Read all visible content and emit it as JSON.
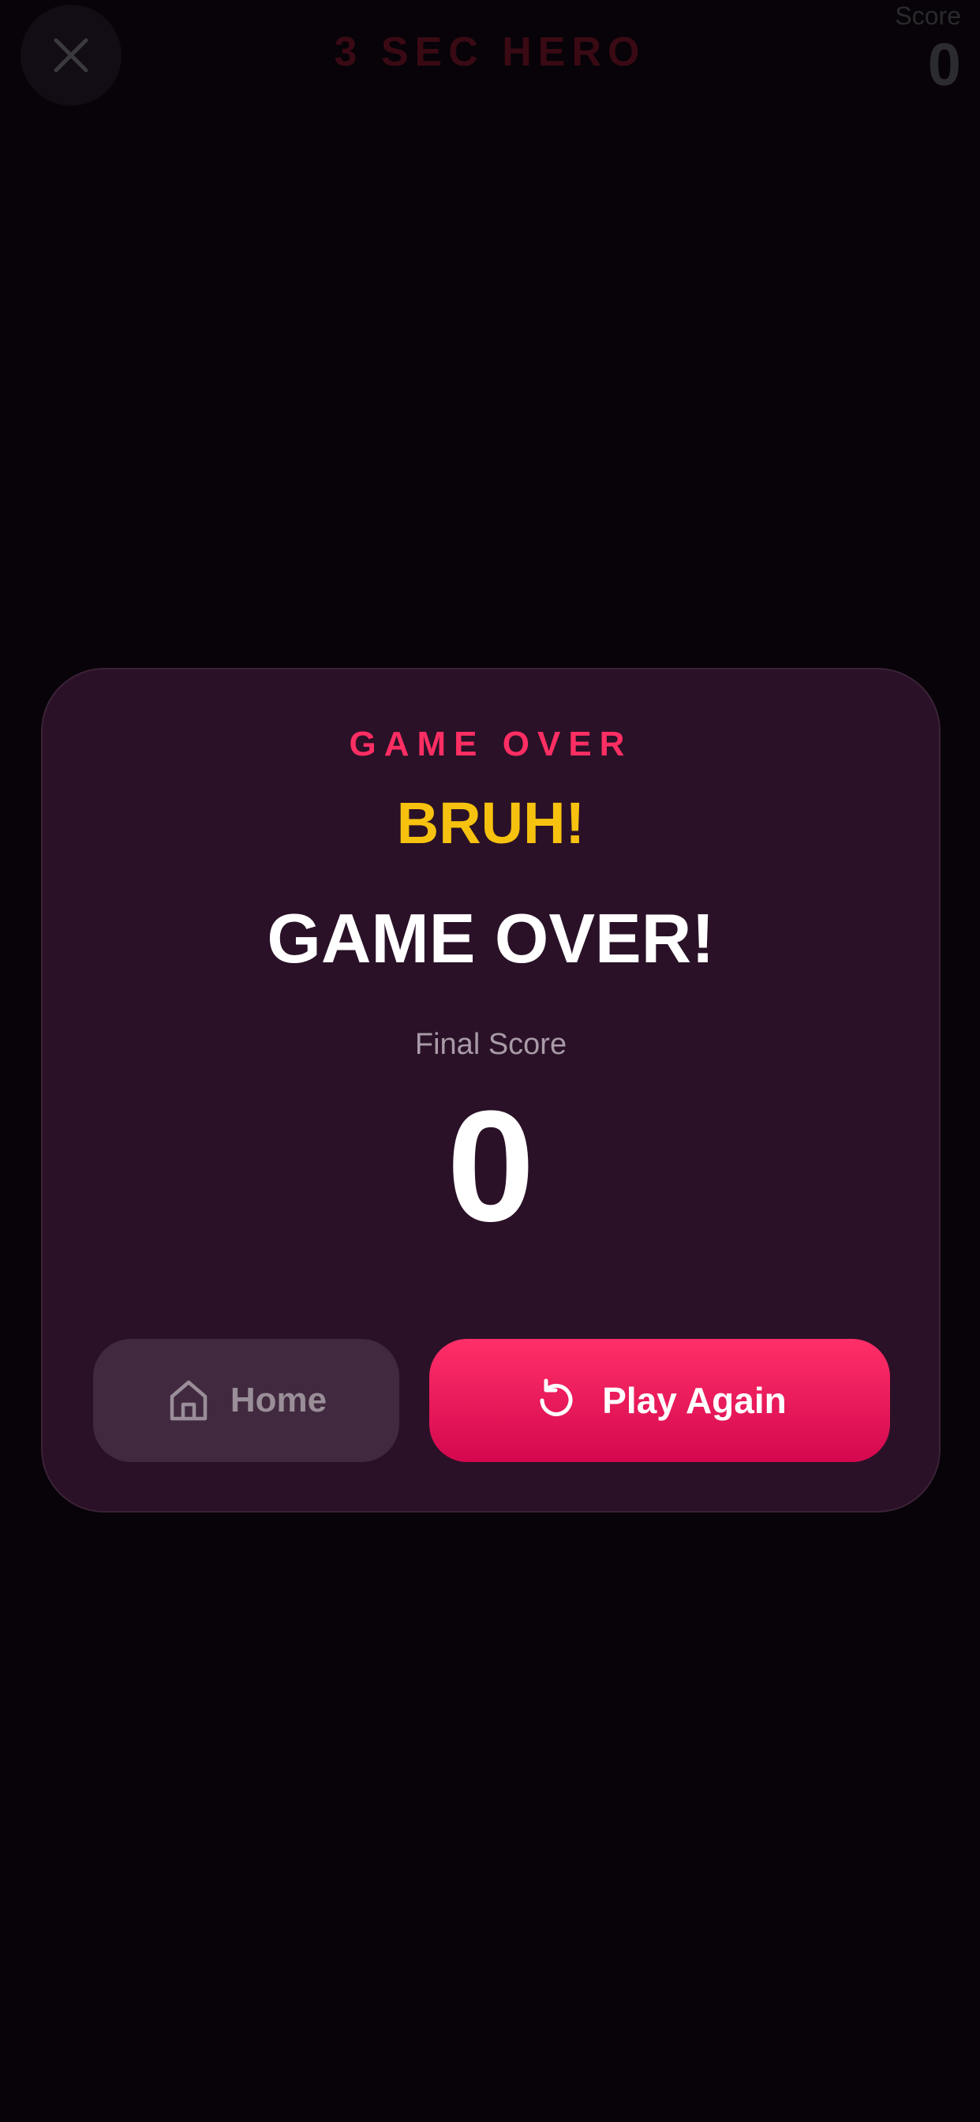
{
  "header": {
    "title": "3 SEC HERO",
    "score_label": "Score",
    "score_value": "0",
    "close_icon": "close-icon"
  },
  "modal": {
    "kicker": "GAME OVER",
    "exclaim": "BRUH!",
    "headline": "GAME OVER!",
    "final_score_label": "Final Score",
    "final_score_value": "0",
    "home_button": {
      "label": "Home",
      "icon": "home-icon"
    },
    "play_again_button": {
      "label": "Play Again",
      "icon": "replay-icon"
    }
  },
  "colors": {
    "background": "#070308",
    "modal_background": "#2a1127",
    "accent_pink": "#ff2e63",
    "accent_yellow": "#f7c20f",
    "secondary_button": "#412a3f"
  }
}
